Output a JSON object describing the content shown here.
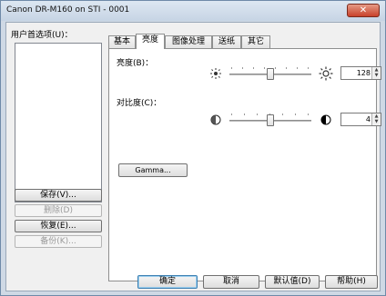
{
  "window": {
    "title": "Canon DR-M160 on STI - 0001",
    "close_label": "✕"
  },
  "prefs": {
    "label": "用户首选项(U)：",
    "buttons": [
      {
        "label": "保存(V)...",
        "enabled": true
      },
      {
        "label": "删除(D)",
        "enabled": false
      },
      {
        "label": "恢复(E)...",
        "enabled": true
      },
      {
        "label": "备份(K)...",
        "enabled": false
      }
    ]
  },
  "tabs": [
    {
      "label": "基本",
      "active": false
    },
    {
      "label": "亮度",
      "active": true
    },
    {
      "label": "图像处理",
      "active": false
    },
    {
      "label": "送纸",
      "active": false
    },
    {
      "label": "其它",
      "active": false
    }
  ],
  "brightness": {
    "label": "亮度(B)：",
    "value": "128",
    "min": 1,
    "max": 255
  },
  "contrast": {
    "label": "对比度(C)：",
    "value": "4",
    "min": 1,
    "max": 7
  },
  "gamma_button": "Gamma...",
  "footer": {
    "ok": "确定",
    "cancel": "取消",
    "default": "默认值(D)",
    "help": "帮助(H)"
  },
  "icons": {
    "brightness_low": "sun-small-icon",
    "brightness_high": "sun-large-icon",
    "contrast_low": "contrast-low-icon",
    "contrast_high": "contrast-high-icon"
  }
}
